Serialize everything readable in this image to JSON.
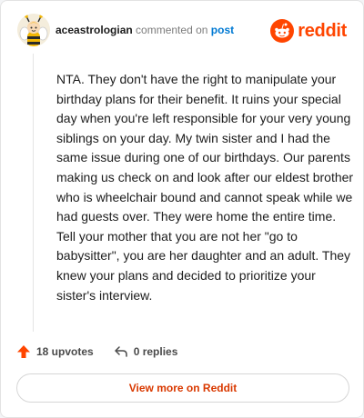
{
  "comment": {
    "author": "aceastrologian",
    "action_text": "commented on",
    "post_link": "post",
    "body": "NTA. They don't have the right to manipulate your birthday plans for their benefit. It ruins your special day when you're left responsible for your very young siblings on your day. My twin sister and I had the same issue during one of our birthdays. Our parents making us check on and look after our eldest brother who is wheelchair bound and cannot speak while we had guests over. They were home the entire time. Tell your mother that you are not her \"go to babysitter\", you are her daughter and an adult. They knew your plans and decided to prioritize your sister's interview."
  },
  "brand": {
    "name": "reddit",
    "icon": "reddit-snoo-icon",
    "color": "#ff4500"
  },
  "stats": {
    "upvotes_label": "18 upvotes",
    "upvote_icon": "upvote-arrow-icon",
    "replies_label": "0 replies",
    "reply_icon": "reply-arrow-icon"
  },
  "cta": {
    "label": "View more on Reddit"
  },
  "colors": {
    "accent": "#d93900",
    "link": "#0079d3",
    "upvote": "#ff4500"
  }
}
